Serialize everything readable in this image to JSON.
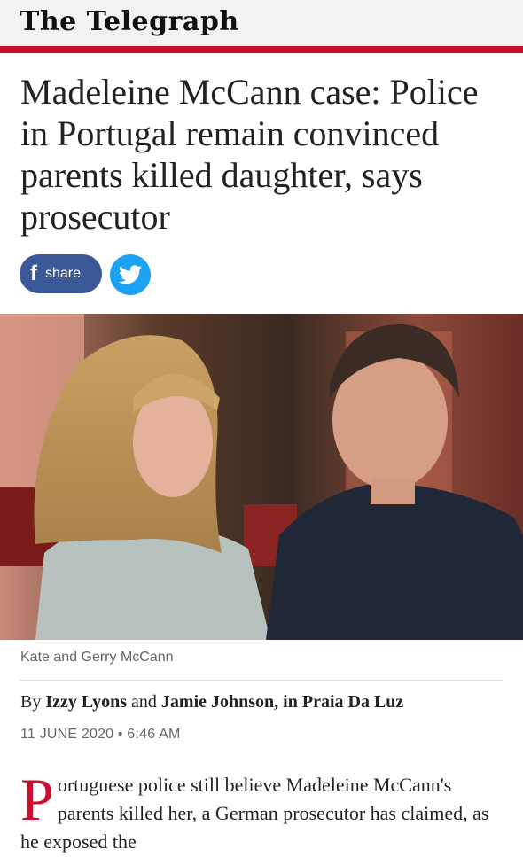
{
  "masthead": {
    "logo": "The Telegraph",
    "accent_color": "#c8102e"
  },
  "article": {
    "headline": "Madeleine McCann case: Police in Portugal remain convinced parents killed daughter, says prosecutor",
    "share": {
      "facebook_label": "share",
      "facebook_icon": "f",
      "twitter_icon": "twitter-bird-icon"
    },
    "image_caption": "Kate and Gerry McCann",
    "byline": {
      "prefix": "By",
      "author1": "Izzy Lyons",
      "joiner": "and",
      "author2": "Jamie Johnson, in Praia Da Luz"
    },
    "date": "11 JUNE 2020 • 6:46 AM",
    "body": {
      "dropcap": "P",
      "text": "ortuguese police still believe Madeleine McCann's parents killed her, a German prosecutor has claimed, as he exposed the"
    }
  },
  "colors": {
    "facebook": "#3b5998",
    "twitter": "#1da1f2"
  }
}
